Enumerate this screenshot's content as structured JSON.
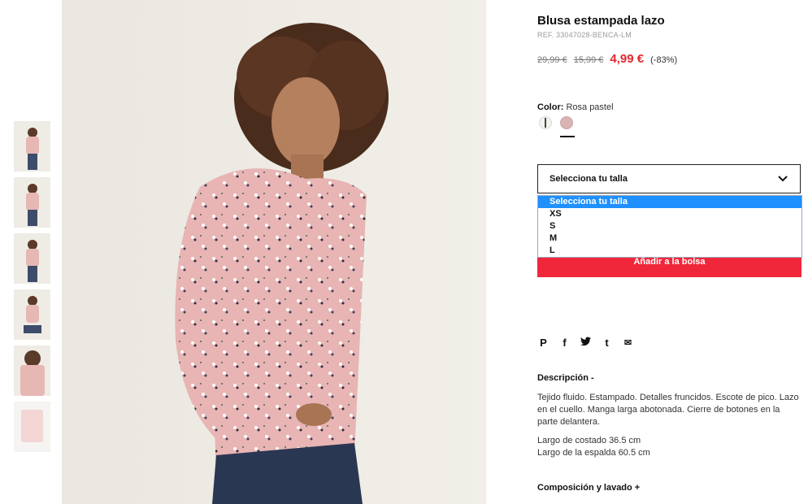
{
  "product": {
    "title": "Blusa estampada lazo",
    "ref": "REF. 33047028-BENCA-LM",
    "price_original": "29,99 €",
    "price_previous": "15,99 €",
    "price_current": "4,99 €",
    "discount": "(-83%)"
  },
  "color": {
    "label": "Color:",
    "value": "Rosa pastel",
    "swatches": [
      {
        "name": "white-print",
        "hex": "#f2f2ee"
      },
      {
        "name": "rosa-pastel",
        "hex": "#d8b5b4",
        "selected": true
      }
    ]
  },
  "size_select": {
    "placeholder": "Selecciona tu talla",
    "options": [
      "Selecciona tu talla",
      "XS",
      "S",
      "M",
      "L"
    ],
    "highlighted": "Selecciona tu talla"
  },
  "add_to_bag_label": "Añadir a la bolsa",
  "share": {
    "pinterest": "P",
    "facebook": "f",
    "twitter": "t",
    "tumblr": "t",
    "email": "✉"
  },
  "description": {
    "title": "Descripción -",
    "paragraph1": "Tejido fluido. Estampado. Detalles fruncidos. Escote de pico. Lazo en el cuello. Manga larga abotonada. Cierre de botones en la parte delantera.",
    "paragraph2_line1": "Largo de costado 36.5 cm",
    "paragraph2_line2": "Largo de la espalda 60.5 cm"
  },
  "composition_title": "Composición y lavado +",
  "colors": {
    "price_red": "#e0282e",
    "button_red": "#f0273b",
    "dropdown_highlight": "#1e90ff"
  }
}
